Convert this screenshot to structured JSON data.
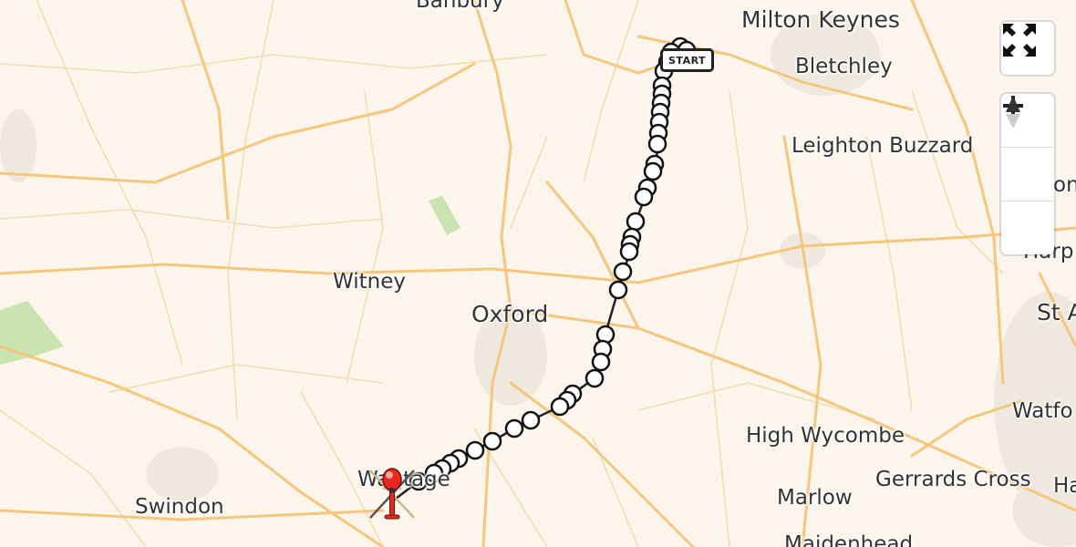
{
  "map": {
    "places": [
      {
        "name": "Banbury"
      },
      {
        "name": "Milton Keynes"
      },
      {
        "name": "Bletchley"
      },
      {
        "name": "Leighton Buzzard"
      },
      {
        "name": "Witney"
      },
      {
        "name": "Oxford"
      },
      {
        "name": "High Wycombe"
      },
      {
        "name": "Gerrards Cross"
      },
      {
        "name": "Marlow"
      },
      {
        "name": "Maidenhead"
      },
      {
        "name": "Swindon"
      },
      {
        "name": "Wantage"
      },
      {
        "name": "Harp"
      },
      {
        "name": "St A"
      },
      {
        "name": "Watfo"
      },
      {
        "name": "Ha"
      },
      {
        "name": "on"
      }
    ],
    "route": {
      "start_label": "START",
      "line_color": "#222222",
      "marker_fill": "#ffffff",
      "destination_icon": "helicopter-icon",
      "destination_color": "#e8271d"
    },
    "colors": {
      "background": "#fbf5ec",
      "major_road": "#f6c77a",
      "minor_road": "#f3d9a8",
      "park": "#c9e3b1"
    }
  },
  "controls": {
    "fullscreen_icon": "fullscreen-icon",
    "zoom_in_icon": "plus-icon",
    "zoom_out_icon": "minus-icon",
    "north_icon": "compass-icon"
  }
}
